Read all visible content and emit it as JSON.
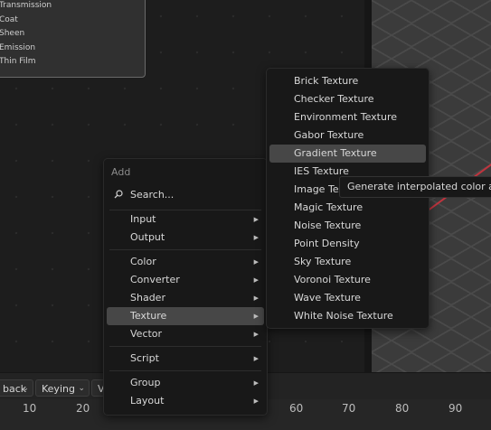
{
  "node": {
    "rows": [
      "Transmission",
      "Coat",
      "Sheen",
      "Emission",
      "Thin Film"
    ]
  },
  "add_menu": {
    "title": "Add",
    "search_label": "Search...",
    "items": [
      {
        "label": "Input",
        "submenu": true
      },
      {
        "label": "Output",
        "submenu": true
      },
      {
        "label": "Color",
        "submenu": true
      },
      {
        "label": "Converter",
        "submenu": true
      },
      {
        "label": "Shader",
        "submenu": true
      },
      {
        "label": "Texture",
        "submenu": true,
        "active": true
      },
      {
        "label": "Vector",
        "submenu": true
      },
      {
        "label": "Script",
        "submenu": true
      },
      {
        "label": "Group",
        "submenu": true
      },
      {
        "label": "Layout",
        "submenu": true
      }
    ]
  },
  "texture_menu": {
    "items": [
      "Brick Texture",
      "Checker Texture",
      "Environment Texture",
      "Gabor Texture",
      "Gradient Texture",
      "IES Texture",
      "Image Texture",
      "Magic Texture",
      "Noise Texture",
      "Point Density",
      "Sky Texture",
      "Voronoi Texture",
      "Wave Texture",
      "White Noise Texture"
    ],
    "active_index": 4
  },
  "tooltip": {
    "text": "Generate interpolated color an"
  },
  "timeline": {
    "playback_label": "back",
    "keying_label": "Keying",
    "view_label": "V",
    "frames": [
      "10",
      "20",
      "60",
      "70",
      "80",
      "90"
    ]
  },
  "colors": {
    "menu_bg": "#181818",
    "highlight": "#474747",
    "x_axis": "#c0343e"
  }
}
